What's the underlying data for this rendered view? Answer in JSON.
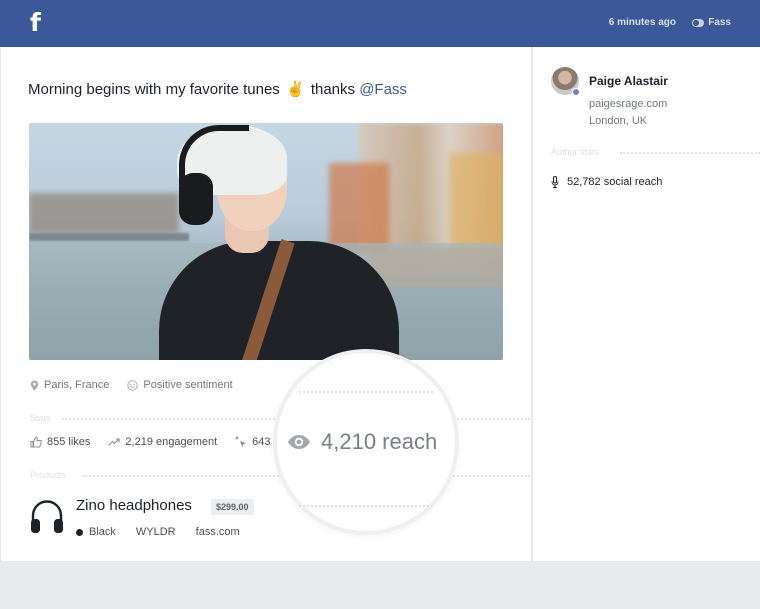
{
  "header": {
    "logo": "f",
    "time": "6 minutes ago",
    "account": "Fass",
    "bg_color": "#3b5998"
  },
  "post": {
    "text_before": "Morning begins with my favorite tunes",
    "emoji": "✌",
    "text_after": "thanks",
    "mention": "@Fass",
    "location": "Paris, France",
    "sentiment": "Positive sentiment"
  },
  "stats": {
    "label": "Stats",
    "likes": "855 likes",
    "engagement": "2,219 engagement",
    "clicks_partial": "643",
    "reach": "4,210 reach"
  },
  "products": {
    "label": "Products",
    "name": "Zino headphones",
    "price": "$299.00",
    "color": "Black",
    "brand": "WYLDR",
    "site": "fass.com"
  },
  "author": {
    "name": "Paige Alastair",
    "website": "paigesrage.com",
    "location": "London, UK",
    "stats_label": "Author stats",
    "social_reach": "52,782 social reach"
  }
}
